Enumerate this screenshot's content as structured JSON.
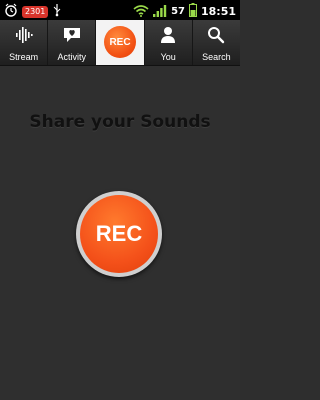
{
  "status_bar": {
    "time": "18:51",
    "battery": "57",
    "notification_badge": "2301",
    "icons": [
      "alarm-icon",
      "notification-badge",
      "usb-icon",
      "wifi-icon",
      "signal-icon",
      "battery-icon"
    ]
  },
  "tabs": [
    {
      "label": "Stream",
      "icon": "waveform-icon"
    },
    {
      "label": "Activity",
      "icon": "heart-bubble-icon"
    },
    {
      "label": "REC",
      "icon": "record-icon"
    },
    {
      "label": "You",
      "icon": "person-icon"
    },
    {
      "label": "Search",
      "icon": "search-icon"
    }
  ],
  "main": {
    "title": "Share your Sounds",
    "rec_button_label": "REC"
  },
  "colors": {
    "accent": "#f4511a",
    "background": "#2f2f2f",
    "tab_active_bg": "#f3f3f3"
  }
}
